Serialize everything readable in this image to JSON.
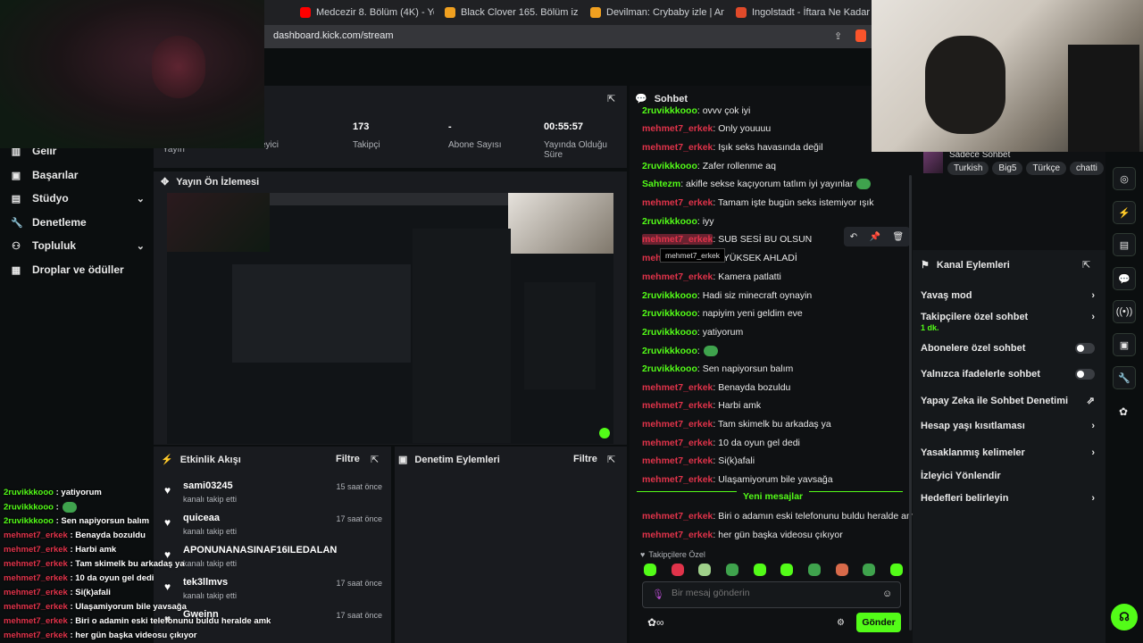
{
  "browser": {
    "tabs": [
      {
        "label": "Medcezir 8. Bölüm (4K) - YouTube",
        "color": "#ff0000"
      },
      {
        "label": "Black Clover 165. Bölüm izle | Anizm",
        "color": "#f0a020"
      },
      {
        "label": "Devilman: Crybaby izle | Anizm",
        "color": "#f0a020"
      },
      {
        "label": "Ingolstadt - İftara Ne Kadar Kaldı - S...",
        "color": "#e04a2a"
      }
    ],
    "url": "dashboard.kick.com/stream"
  },
  "nav": {
    "items": [
      {
        "label": "Gelir",
        "icon": "bank-icon"
      },
      {
        "label": "Başarılar",
        "icon": "trophy-icon"
      },
      {
        "label": "Stüdyo",
        "icon": "studio-icon",
        "chevron": true
      },
      {
        "label": "Denetleme",
        "icon": "wrench-icon"
      },
      {
        "label": "Topluluk",
        "icon": "community-icon",
        "chevron": true
      },
      {
        "label": "Droplar ve ödüller",
        "icon": "drops-icon"
      }
    ]
  },
  "stats": {
    "col1_lbl": "Yayın",
    "col2_lbl": "İzleyici",
    "followers_val": "173",
    "followers_lbl": "Takipçi",
    "subs_val": "-",
    "subs_lbl": "Abone Sayısı",
    "uptime_val": "00:55:57",
    "uptime_lbl": "Yayında Olduğu Süre"
  },
  "preview": {
    "title": "Yayın Ön İzlemesi"
  },
  "activity": {
    "title": "Etkinlik Akışı",
    "filter": "Filtre",
    "items": [
      {
        "name": "sami03245",
        "sub": "kanalı takip etti",
        "time": "15 saat önce"
      },
      {
        "name": "quiceaa",
        "sub": "kanalı takip etti",
        "time": "17 saat önce"
      },
      {
        "name": "APONUNANASINAF16ILEDALAN",
        "sub": "kanalı takip etti",
        "time": "17 saat önce"
      },
      {
        "name": "tek3llmvs",
        "sub": "kanalı takip etti",
        "time": "17 saat önce"
      },
      {
        "name": "Gweinn",
        "sub": "",
        "time": "17 saat önce"
      }
    ]
  },
  "moderation": {
    "title": "Denetim Eylemleri",
    "filter": "Filtre"
  },
  "chat": {
    "title": "Sohbet",
    "messages": [
      {
        "user": "2ruvikkkooo",
        "color": "green",
        "text": ": ovvv çok iyi"
      },
      {
        "user": "mehmet7_erkek",
        "color": "red",
        "text": ": Only youuuu"
      },
      {
        "user": "mehmet7_erkek",
        "color": "red",
        "text": ": Işık seks havasında değil"
      },
      {
        "user": "2ruvikkkooo",
        "color": "green",
        "text": ": Zafer rollenme aq"
      },
      {
        "user": "Sahtezm",
        "color": "green",
        "text": ": akifle sekse kaçıyorum tatlım iyi yayınlar"
      },
      {
        "user": "mehmet7_erkek",
        "color": "red",
        "text": ": Tamam işte bugün seks istemiyor ışık"
      },
      {
        "user": "2ruvikkkooo",
        "color": "green",
        "text": ": iyy"
      },
      {
        "user": "mehmet7_erkek",
        "color": "red",
        "text": ": SUB SESİ BU OLSUN"
      },
      {
        "user": "mehmet7_erkek",
        "color": "red",
        "text": "... YÜKSEK AHLADİ"
      },
      {
        "user": "mehmet7_erkek",
        "color": "red",
        "text": ": Kamera patlatti"
      },
      {
        "user": "2ruvikkkooo",
        "color": "green",
        "text": ": Hadi siz minecraft oynayin"
      },
      {
        "user": "2ruvikkkooo",
        "color": "green",
        "text": ": napiyim yeni geldim eve"
      },
      {
        "user": "2ruvikkkooo",
        "color": "green",
        "text": ": yatiyorum"
      },
      {
        "user": "2ruvikkkooo",
        "color": "green",
        "text": ":"
      },
      {
        "user": "2ruvikkkooo",
        "color": "green",
        "text": ": Sen napiyorsun balım"
      },
      {
        "user": "mehmet7_erkek",
        "color": "red",
        "text": ": Benayda bozuldu"
      },
      {
        "user": "mehmet7_erkek",
        "color": "red",
        "text": ": Harbi amk"
      },
      {
        "user": "mehmet7_erkek",
        "color": "red",
        "text": ": Tam skimelk bu arkadaş ya"
      },
      {
        "user": "mehmet7_erkek",
        "color": "red",
        "text": ": 10 da oyun gel dedi"
      },
      {
        "user": "mehmet7_erkek",
        "color": "red",
        "text": ": Si(k)afali"
      },
      {
        "user": "mehmet7_erkek",
        "color": "red",
        "text": ": Ulaşamiyorum bile yavsağa"
      }
    ],
    "new_divider": "Yeni mesajlar",
    "new_messages": [
      {
        "user": "mehmet7_erkek",
        "color": "red",
        "text": ": Biri o adamın eski telefonunu buldu heralde amk"
      },
      {
        "user": "mehmet7_erkek",
        "color": "red",
        "text": ": her gün başka videosu çıkıyor"
      }
    ],
    "tooltip": "mehmet7_erkek",
    "followers_only_label": "Takipçilere Özel",
    "input_placeholder": "Bir mesaj gönderin",
    "send_label": "Gönder"
  },
  "channel_info": {
    "title_partial": "Sadece Sohbet",
    "tags": [
      "Turkish",
      "Big5",
      "Türkçe",
      "chatti"
    ]
  },
  "channel_actions": {
    "title": "Kanal Eylemleri",
    "items": [
      {
        "label": "Yavaş mod",
        "kind": "chevron"
      },
      {
        "label": "Takipçilere özel sohbet",
        "kind": "chevron",
        "sub": "1 dk."
      },
      {
        "label": "Abonelere özel sohbet",
        "kind": "toggle"
      },
      {
        "label": "Yalnızca ifadelerle sohbet",
        "kind": "toggle"
      },
      {
        "label": "Yapay Zeka ile Sohbet Denetimi",
        "kind": "external"
      },
      {
        "label": "Hesap yaşı kısıtlaması",
        "kind": "chevron"
      },
      {
        "label": "Yasaklanmış kelimeler",
        "kind": "chevron"
      },
      {
        "label": "İzleyici Yönlendir",
        "kind": "none"
      },
      {
        "label": "Hedefleri belirleyin",
        "kind": "chevron"
      }
    ]
  },
  "overlay_chat": [
    {
      "user": "2ruvikkkooo",
      "color": "green",
      "text": " : yatiyorum"
    },
    {
      "user": "2ruvikkkooo",
      "color": "green",
      "text": " :"
    },
    {
      "user": "2ruvikkkooo",
      "color": "green",
      "text": " : Sen napiyorsun balım"
    },
    {
      "user": "mehmet7_erkek",
      "color": "red",
      "text": " : Benayda bozuldu"
    },
    {
      "user": "mehmet7_erkek",
      "color": "red",
      "text": " : Harbi amk"
    },
    {
      "user": "mehmet7_erkek",
      "color": "red",
      "text": " : Tam skimelk bu arkadaş ya"
    },
    {
      "user": "mehmet7_erkek",
      "color": "red",
      "text": " : 10 da oyun gel dedi"
    },
    {
      "user": "mehmet7_erkek",
      "color": "red",
      "text": " : Si(k)afali"
    },
    {
      "user": "mehmet7_erkek",
      "color": "red",
      "text": " : Ulaşamiyorum bile yavsağa"
    },
    {
      "user": "mehmet7_erkek",
      "color": "red",
      "text": " : Biri o adamin eski telefonunu buldu heralde amk"
    },
    {
      "user": "mehmet7_erkek",
      "color": "red",
      "text": " : her gün başka videosu çıkıyor"
    }
  ],
  "colors": {
    "accent": "#53fc18",
    "red_user": "#e0334a"
  }
}
